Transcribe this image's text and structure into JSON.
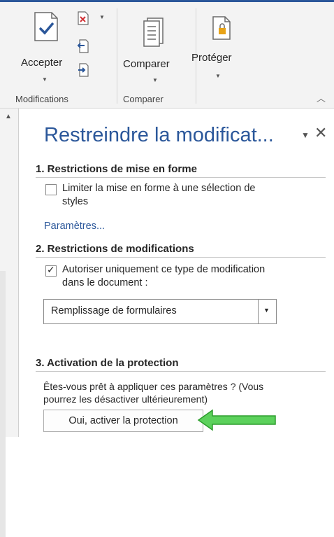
{
  "ribbon": {
    "accept_label": "Accepter",
    "compare_label": "Comparer",
    "protect_label": "Protéger",
    "group_modifications": "Modifications",
    "group_compare": "Comparer"
  },
  "pane": {
    "title": "Restreindre la modificat...",
    "section1": {
      "heading": "1. Restrictions de mise en forme",
      "checkbox_label_line1": "Limiter la mise en forme à une sélection de",
      "checkbox_label_line2": "styles",
      "checkbox_checked": false,
      "settings_link": "Paramètres..."
    },
    "section2": {
      "heading": "2. Restrictions de modifications",
      "checkbox_label_line1": "Autoriser uniquement ce type de modification",
      "checkbox_label_line2": "dans le document :",
      "checkbox_checked": true,
      "select_value": "Remplissage de formulaires"
    },
    "section3": {
      "heading": "3. Activation de la protection",
      "description_line1": "Êtes-vous prêt à appliquer ces paramètres ? (Vous",
      "description_line2": "pourrez les désactiver ultérieurement)",
      "button_label": "Oui, activer la protection"
    }
  },
  "colors": {
    "accent": "#2b579a",
    "arrow": "#5cd15c"
  },
  "icons": [
    "accept-icon",
    "reject-icon",
    "previous-change-icon",
    "next-change-icon",
    "compare-icon",
    "protect-document-icon",
    "collapse-ribbon-icon",
    "pane-options-icon",
    "close-icon",
    "checkbox-checkmark-icon",
    "dropdown-arrow-icon",
    "pointer-arrow-icon"
  ]
}
